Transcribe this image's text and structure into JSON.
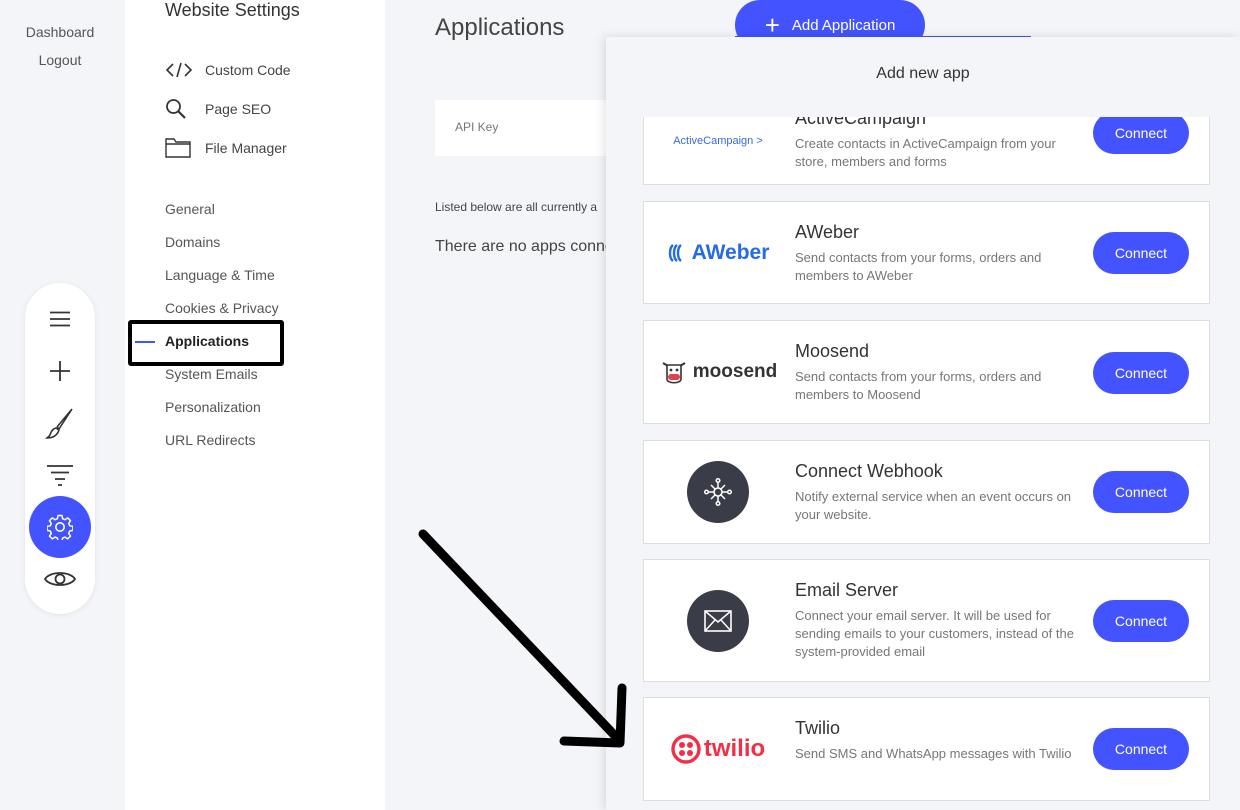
{
  "top_links": {
    "dashboard": "Dashboard",
    "logout": "Logout"
  },
  "toolbar": {
    "items": [
      "menu-icon",
      "plus-icon",
      "brush-icon",
      "filter-icon",
      "gear-icon",
      "eye-icon"
    ],
    "active": "gear-icon"
  },
  "settings": {
    "title": "Website Settings",
    "tools": [
      {
        "label": "Custom Code",
        "icon": "code-icon"
      },
      {
        "label": "Page SEO",
        "icon": "search-icon"
      },
      {
        "label": "File Manager",
        "icon": "folder-icon"
      }
    ],
    "nav": [
      "General",
      "Domains",
      "Language & Time",
      "Cookies & Privacy",
      "Applications",
      "System Emails",
      "Personalization",
      "URL Redirects"
    ],
    "active_nav": "Applications"
  },
  "main": {
    "title": "Applications",
    "add_button": "Add Application",
    "api_key_label": "API Key",
    "listed_text": "Listed below are all currently a",
    "no_apps_text": "There are no apps conne"
  },
  "modal": {
    "title": "Add new app",
    "apps": [
      {
        "name": "ActiveCampaign",
        "logo_text": "ActiveCampaign >",
        "desc": "Create contacts in ActiveCampaign from your store, members and forms",
        "button": "Connect"
      },
      {
        "name": "AWeber",
        "logo_text": "AWeber",
        "desc": "Send contacts from your forms, orders and members to AWeber",
        "button": "Connect"
      },
      {
        "name": "Moosend",
        "logo_text": "moosend",
        "desc": "Send contacts from your forms, orders and members to Moosend",
        "button": "Connect"
      },
      {
        "name": "Connect Webhook",
        "icon": "webhook-icon",
        "desc": "Notify external service when an event occurs on your website.",
        "button": "Connect"
      },
      {
        "name": "Email Server",
        "icon": "envelope-icon",
        "desc": "Connect your email server. It will be used for sending emails to your customers, instead of the system-provided email",
        "button": "Connect"
      },
      {
        "name": "Twilio",
        "logo_text": "twilio",
        "desc": "Send SMS and WhatsApp messages with Twilio",
        "button": "Connect"
      }
    ]
  },
  "colors": {
    "accent": "#4353ff",
    "twilio": "#f22f46",
    "aweber": "#246be8",
    "activecampaign": "#356ae6"
  }
}
